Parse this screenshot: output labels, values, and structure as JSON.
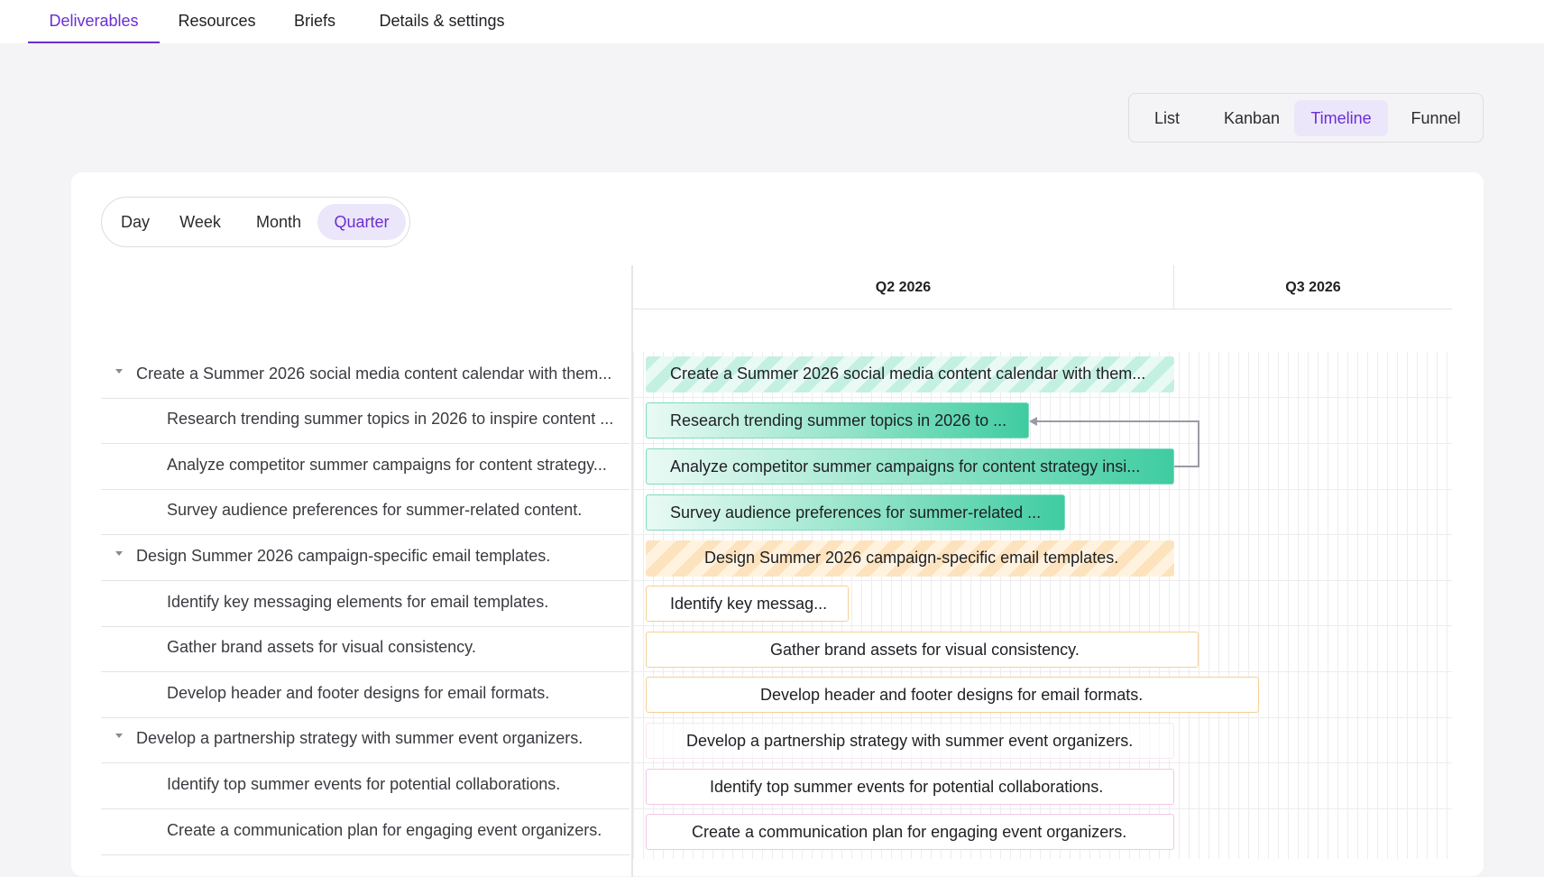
{
  "topnav": {
    "tabs": [
      {
        "label": "Deliverables",
        "active": true
      },
      {
        "label": "Resources",
        "active": false
      },
      {
        "label": "Briefs",
        "active": false
      },
      {
        "label": "Details & settings",
        "active": false
      }
    ]
  },
  "view_switch": {
    "options": [
      "List",
      "Kanban",
      "Timeline",
      "Funnel"
    ],
    "selected": "Timeline"
  },
  "zoom": {
    "options": [
      "Day",
      "Week",
      "Month",
      "Quarter"
    ],
    "selected": "Quarter"
  },
  "timeline": {
    "quarters": [
      "Q2 2026",
      "Q3 2026"
    ]
  },
  "tasks": [
    {
      "label": "Create a Summer 2026 social media content calendar with them...",
      "bar_text": "Create a Summer 2026 social media content calendar with them...",
      "parent": true
    },
    {
      "label": "Research trending summer topics in 2026 to inspire content ...",
      "bar_text": "Research trending summer topics in 2026 to ...",
      "parent": false
    },
    {
      "label": "Analyze competitor summer campaigns for content strategy...",
      "bar_text": "Analyze competitor summer campaigns for content strategy insi...",
      "parent": false
    },
    {
      "label": "Survey audience preferences for summer-related content.",
      "bar_text": "Survey audience preferences for summer-related ...",
      "parent": false
    },
    {
      "label": "Design Summer 2026 campaign-specific email templates.",
      "bar_text": "Design Summer 2026 campaign-specific email templates.",
      "parent": true
    },
    {
      "label": "Identify key messaging elements for email templates.",
      "bar_text": "Identify key messag...",
      "parent": false
    },
    {
      "label": "Gather brand assets for visual consistency.",
      "bar_text": "Gather brand assets for visual consistency.",
      "parent": false
    },
    {
      "label": "Develop header and footer designs for email formats.",
      "bar_text": "Develop header and footer designs for email formats.",
      "parent": false
    },
    {
      "label": "Develop a partnership strategy with summer event organizers.",
      "bar_text": "Develop a partnership strategy with summer event organizers.",
      "parent": true
    },
    {
      "label": "Identify top summer events for potential collaborations.",
      "bar_text": "Identify top summer events for potential collaborations.",
      "parent": false
    },
    {
      "label": "Create a communication plan for engaging event organizers.",
      "bar_text": "Create a communication plan for engaging event organizers.",
      "parent": false
    }
  ],
  "colors": {
    "accent": "#6b2fd1",
    "accent_bg": "#ece6fb",
    "group_green": "#3fcca0",
    "group_orange": "#f6cf96",
    "group_pink": "#f3c7e6"
  }
}
